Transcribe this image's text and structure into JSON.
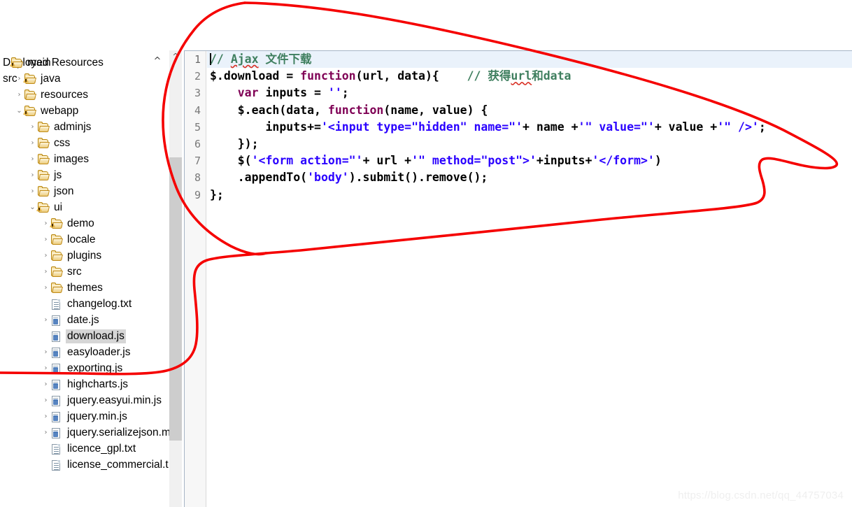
{
  "explorer": {
    "title": "Deployed Resources",
    "second_root": "src",
    "collapse_icon": "chevron-up-icon",
    "items": [
      {
        "label": "main",
        "indent": 0,
        "twisty": "none",
        "icon": "folder-decorated"
      },
      {
        "label": "java",
        "indent": 1,
        "twisty": "collapsed",
        "icon": "folder-decorated"
      },
      {
        "label": "resources",
        "indent": 1,
        "twisty": "collapsed",
        "icon": "folder"
      },
      {
        "label": "webapp",
        "indent": 1,
        "twisty": "expanded",
        "icon": "folder-decorated"
      },
      {
        "label": "adminjs",
        "indent": 2,
        "twisty": "collapsed",
        "icon": "folder"
      },
      {
        "label": "css",
        "indent": 2,
        "twisty": "collapsed",
        "icon": "folder"
      },
      {
        "label": "images",
        "indent": 2,
        "twisty": "collapsed",
        "icon": "folder"
      },
      {
        "label": "js",
        "indent": 2,
        "twisty": "collapsed",
        "icon": "folder"
      },
      {
        "label": "json",
        "indent": 2,
        "twisty": "collapsed",
        "icon": "folder"
      },
      {
        "label": "ui",
        "indent": 2,
        "twisty": "expanded",
        "icon": "folder-decorated"
      },
      {
        "label": "demo",
        "indent": 3,
        "twisty": "collapsed",
        "icon": "folder-decorated"
      },
      {
        "label": "locale",
        "indent": 3,
        "twisty": "collapsed",
        "icon": "folder"
      },
      {
        "label": "plugins",
        "indent": 3,
        "twisty": "collapsed",
        "icon": "folder"
      },
      {
        "label": "src",
        "indent": 3,
        "twisty": "collapsed",
        "icon": "folder"
      },
      {
        "label": "themes",
        "indent": 3,
        "twisty": "collapsed",
        "icon": "folder"
      },
      {
        "label": "changelog.txt",
        "indent": 3,
        "twisty": "none",
        "icon": "text-file"
      },
      {
        "label": "date.js",
        "indent": 3,
        "twisty": "collapsed",
        "icon": "js-file"
      },
      {
        "label": "download.js",
        "indent": 3,
        "twisty": "none",
        "icon": "js-file",
        "selected": true
      },
      {
        "label": "easyloader.js",
        "indent": 3,
        "twisty": "collapsed",
        "icon": "js-file"
      },
      {
        "label": "exporting.js",
        "indent": 3,
        "twisty": "collapsed",
        "icon": "js-file"
      },
      {
        "label": "highcharts.js",
        "indent": 3,
        "twisty": "collapsed",
        "icon": "js-file"
      },
      {
        "label": "jquery.easyui.min.js",
        "indent": 3,
        "twisty": "collapsed",
        "icon": "js-file"
      },
      {
        "label": "jquery.min.js",
        "indent": 3,
        "twisty": "collapsed",
        "icon": "js-file"
      },
      {
        "label": "jquery.serializejson.m",
        "indent": 3,
        "twisty": "collapsed",
        "icon": "js-file"
      },
      {
        "label": "licence_gpl.txt",
        "indent": 3,
        "twisty": "none",
        "icon": "text-file"
      },
      {
        "label": "license_commercial.t",
        "indent": 3,
        "twisty": "none",
        "icon": "text-file"
      }
    ]
  },
  "scrollbar": {
    "up_arrow_icon": "chevron-up-icon"
  },
  "editor": {
    "current_line": 1,
    "line_numbers": [
      "1",
      "2",
      "3",
      "4",
      "5",
      "6",
      "7",
      "8",
      "9"
    ],
    "lines": [
      {
        "n": "1",
        "current": true,
        "tokens": [
          {
            "t": "caret"
          },
          {
            "t": "comment",
            "text": "// "
          },
          {
            "t": "comment-squiggle",
            "text": "Ajax"
          },
          {
            "t": "comment",
            "text": " 文件下载"
          }
        ]
      },
      {
        "n": "2",
        "current": false,
        "tokens": [
          {
            "t": "plain",
            "text": "$.download = "
          },
          {
            "t": "keyword",
            "text": "function"
          },
          {
            "t": "plain",
            "text": "(url, data){    "
          },
          {
            "t": "comment",
            "text": "// "
          },
          {
            "t": "comment",
            "text": "获得"
          },
          {
            "t": "comment-squiggle",
            "text": "url"
          },
          {
            "t": "comment",
            "text": "和data"
          }
        ]
      },
      {
        "n": "3",
        "current": false,
        "tokens": [
          {
            "t": "plain",
            "text": "    "
          },
          {
            "t": "keyword",
            "text": "var"
          },
          {
            "t": "plain",
            "text": " inputs = "
          },
          {
            "t": "string",
            "text": "''"
          },
          {
            "t": "plain",
            "text": ";"
          }
        ]
      },
      {
        "n": "4",
        "current": false,
        "tokens": [
          {
            "t": "plain",
            "text": "    $.each(data, "
          },
          {
            "t": "keyword",
            "text": "function"
          },
          {
            "t": "plain",
            "text": "(name, value) {"
          }
        ]
      },
      {
        "n": "5",
        "current": false,
        "tokens": [
          {
            "t": "plain",
            "text": "        inputs+="
          },
          {
            "t": "string",
            "text": "'<input type=\"hidden\" name=\"'"
          },
          {
            "t": "plain",
            "text": "+ name +"
          },
          {
            "t": "string",
            "text": "'\" value=\"'"
          },
          {
            "t": "plain",
            "text": "+ value +"
          },
          {
            "t": "string",
            "text": "'\" />'"
          },
          {
            "t": "plain",
            "text": ";"
          }
        ]
      },
      {
        "n": "6",
        "current": false,
        "tokens": [
          {
            "t": "plain",
            "text": "    });"
          }
        ]
      },
      {
        "n": "7",
        "current": false,
        "tokens": [
          {
            "t": "plain",
            "text": "    $("
          },
          {
            "t": "string",
            "text": "'<form action=\"'"
          },
          {
            "t": "plain",
            "text": "+ url +"
          },
          {
            "t": "string",
            "text": "'\" method=\"post\">'"
          },
          {
            "t": "plain",
            "text": "+inputs+"
          },
          {
            "t": "string",
            "text": "'</form>'"
          },
          {
            "t": "plain",
            "text": ")"
          }
        ]
      },
      {
        "n": "8",
        "current": false,
        "tokens": [
          {
            "t": "plain",
            "text": "    .appendTo("
          },
          {
            "t": "string",
            "text": "'body'"
          },
          {
            "t": "plain",
            "text": ").submit().remove();"
          }
        ]
      },
      {
        "n": "9",
        "current": false,
        "tokens": [
          {
            "t": "plain",
            "text": "};"
          }
        ]
      }
    ]
  },
  "annotation": {
    "name": "red-freehand-lasso",
    "color": "#f50000",
    "stroke_width": 3.6
  },
  "watermark": {
    "text": "https://blog.csdn.net/qq_44757034"
  },
  "colors": {
    "comment": "#3f7f5f",
    "keyword": "#7f0055",
    "string": "#2a00ff",
    "current_line_bg": "#eaf2fb",
    "selection_bg": "#d6d6d6",
    "annotation_red": "#f50000"
  }
}
